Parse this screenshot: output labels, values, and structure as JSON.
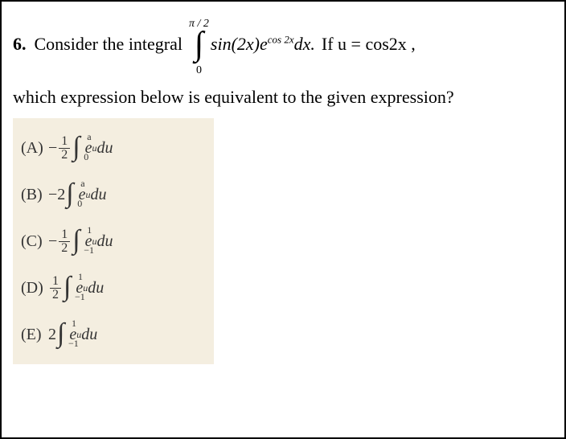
{
  "question": {
    "number": "6.",
    "lead": "Consider the integral",
    "upper_limit": "π / 2",
    "lower_limit": "0",
    "integrand_base": "sin(2x)e",
    "integrand_exp": "cos 2x",
    "integrand_dx": "dx.",
    "tail": "If  u = cos2x ,",
    "continuation": "which expression below is equivalent to the given expression?"
  },
  "choices": {
    "A": {
      "label": "(A)",
      "prefix": "−",
      "frac_num": "1",
      "frac_den": "2",
      "int_top": "a",
      "int_bot": "0",
      "body": "e",
      "body_sup": "u",
      "du": " du"
    },
    "B": {
      "label": "(B)",
      "prefix": "−2",
      "int_top": "a",
      "int_bot": "0",
      "body": "e",
      "body_sup": "u",
      "du": " du"
    },
    "C": {
      "label": "(C)",
      "prefix": "−",
      "frac_num": "1",
      "frac_den": "2",
      "int_top": "1",
      "int_bot": "−1",
      "body": "e",
      "body_sup": "u",
      "du": " du"
    },
    "D": {
      "label": "(D)",
      "prefix": "",
      "frac_num": "1",
      "frac_den": "2",
      "int_top": "1",
      "int_bot": "−1",
      "body": "e",
      "body_sup": "u",
      "du": " du"
    },
    "E": {
      "label": "(E)",
      "prefix": "2",
      "int_top": "1",
      "int_bot": "−1",
      "body": "e",
      "body_sup": "u",
      "du": " du"
    }
  }
}
